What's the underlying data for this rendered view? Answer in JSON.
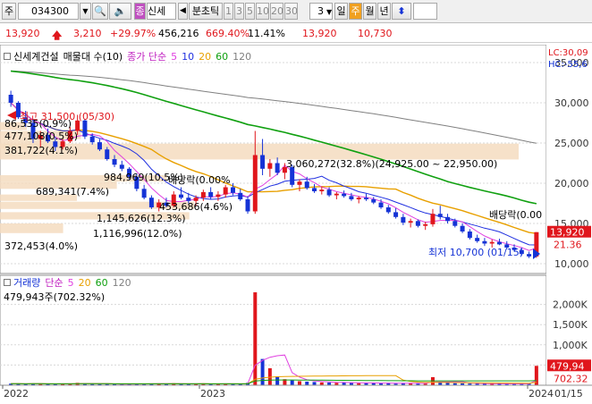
{
  "toolbar": {
    "market": "주",
    "code": "034300",
    "search_icon": "magnifier-icon",
    "sound_icon": "speaker-icon",
    "related_btn": "종",
    "name": "신세",
    "prev_icon": "triangle-left-icon",
    "tick_label": "분초틱",
    "periods": [
      "1",
      "3",
      "5",
      "10",
      "20",
      "30"
    ],
    "count": "3",
    "frames": [
      "일",
      "주",
      "월",
      "년"
    ],
    "active_frame": "주",
    "updown_icon": "up-down-arrow-icon"
  },
  "quote": {
    "price": "13,920",
    "up_icon": "red-up-arrow-icon",
    "change": "3,210",
    "change_pct": "+29.97%",
    "volume": "456,216",
    "volume_pct": "669.40%",
    "turnover": "11.41%",
    "high": "13,920",
    "low": "10,730"
  },
  "price_legend": {
    "name": "신세계건설",
    "series": "매물대 수(10)",
    "ma_label": "종가 단순",
    "ma": [
      "5",
      "10",
      "20",
      "60",
      "120"
    ],
    "ma_colors": [
      "#e040e0",
      "#2030e0",
      "#e8a000",
      "#10a010",
      "#808080"
    ],
    "lc_label": "LC:30,09",
    "hc_label": "HC:-55,6"
  },
  "volume_legend": {
    "name": "거래량",
    "ma_label": "단순",
    "ma": [
      "5",
      "20",
      "60",
      "120"
    ],
    "value": "479,943주(702.32%)"
  },
  "volume_profile": [
    {
      "label": "3,060,272(32.8%)(24,925.00 ~ 22,950.00)",
      "value": 3060272
    },
    {
      "label": "1,145,626(12.3%)",
      "value": 1145626
    },
    {
      "label": "1,116,996(12.0%)",
      "value": 1116996
    },
    {
      "label": "984,969(10.5%)",
      "value": 984969
    },
    {
      "label": "689,341(7.4%)",
      "value": 689341
    },
    {
      "label": "453,686(4.6%)",
      "value": 453686
    },
    {
      "label": "381,722(4.1%)",
      "value": 381722
    },
    {
      "label": "477,108(0.5%)",
      "value": 477108
    },
    {
      "label": "86,535(0.9%)",
      "value": 86535
    },
    {
      "label": "372,453(4.0%)",
      "value": 372453
    }
  ],
  "annotations": {
    "high": "최고 31,500 (05/30)",
    "low": "최저 10,700 (01/15)",
    "dividend1": "배당락(0.00%",
    "dividend2": "배당락(0.00"
  },
  "price_axis": {
    "ticks": [
      "35,000",
      "30,000",
      "25,000",
      "20,000",
      "15,000",
      "10,000"
    ],
    "current": "13,920",
    "current_pct": "21.36"
  },
  "volume_axis": {
    "ticks": [
      "2,000K",
      "1,500K",
      "1,000K",
      "500K"
    ],
    "current": "479,94",
    "current_pct": "702.32"
  },
  "x_labels": [
    "2022",
    "2023",
    "2024"
  ],
  "x_last": "01/15",
  "chart_data": {
    "type": "candlestick",
    "unit": "KRW",
    "interval": "weekly",
    "ohlc": [
      [
        31000,
        31500,
        29500,
        30000
      ],
      [
        30000,
        30200,
        28000,
        28200
      ],
      [
        28200,
        29000,
        27000,
        27500
      ],
      [
        27500,
        28000,
        25000,
        25500
      ],
      [
        25500,
        26500,
        24500,
        26000
      ],
      [
        26000,
        26800,
        25000,
        25200
      ],
      [
        25200,
        25800,
        24000,
        24500
      ],
      [
        24500,
        25500,
        24200,
        25200
      ],
      [
        25200,
        27000,
        25000,
        26500
      ],
      [
        26500,
        28500,
        26000,
        27800
      ],
      [
        27800,
        28000,
        25500,
        25800
      ],
      [
        25800,
        26200,
        24800,
        25100
      ],
      [
        25100,
        25500,
        24000,
        24200
      ],
      [
        24200,
        24500,
        22800,
        23000
      ],
      [
        23000,
        23500,
        22000,
        22300
      ],
      [
        22300,
        22800,
        21500,
        21800
      ],
      [
        21800,
        22000,
        20500,
        20800
      ],
      [
        20800,
        21200,
        19000,
        19300
      ],
      [
        19300,
        19800,
        18000,
        18200
      ],
      [
        18200,
        18500,
        16800,
        17000
      ],
      [
        17000,
        18000,
        16500,
        17600
      ],
      [
        17600,
        18200,
        17000,
        17200
      ],
      [
        17200,
        19000,
        17000,
        18600
      ],
      [
        18600,
        19500,
        18000,
        18200
      ],
      [
        18200,
        18800,
        17500,
        17800
      ],
      [
        17800,
        18500,
        17200,
        18200
      ],
      [
        18200,
        19200,
        17800,
        18900
      ],
      [
        18900,
        19500,
        18000,
        18300
      ],
      [
        18300,
        19000,
        17800,
        18600
      ],
      [
        18600,
        19800,
        18200,
        19500
      ],
      [
        19500,
        20000,
        18500,
        18800
      ],
      [
        18800,
        19300,
        17800,
        18000
      ],
      [
        18000,
        18400,
        16200,
        16500
      ],
      [
        16500,
        26500,
        16200,
        23500
      ],
      [
        23500,
        25500,
        21000,
        21800
      ],
      [
        21800,
        23000,
        20800,
        22500
      ],
      [
        22500,
        23200,
        21000,
        21300
      ],
      [
        21300,
        22500,
        20500,
        22000
      ],
      [
        22000,
        22300,
        19500,
        19800
      ],
      [
        19800,
        20500,
        19000,
        20200
      ],
      [
        20200,
        20800,
        19200,
        19400
      ],
      [
        19400,
        19900,
        18800,
        19000
      ],
      [
        19000,
        19600,
        18600,
        19200
      ],
      [
        19200,
        19500,
        18300,
        18500
      ],
      [
        18500,
        18900,
        18000,
        18700
      ],
      [
        18700,
        19100,
        18200,
        18400
      ],
      [
        18400,
        18800,
        17800,
        18000
      ],
      [
        18000,
        18400,
        17500,
        18200
      ],
      [
        18200,
        18700,
        17800,
        18000
      ],
      [
        18000,
        18300,
        17400,
        17600
      ],
      [
        17600,
        18000,
        16800,
        17000
      ],
      [
        17000,
        17300,
        16200,
        16400
      ],
      [
        16400,
        16900,
        15600,
        15800
      ],
      [
        15800,
        16200,
        14800,
        15100
      ],
      [
        15100,
        15600,
        14500,
        15300
      ],
      [
        15300,
        15500,
        14500,
        14700
      ],
      [
        14700,
        15200,
        14200,
        14900
      ],
      [
        14900,
        16800,
        14600,
        16200
      ],
      [
        16200,
        17200,
        15500,
        15800
      ],
      [
        15800,
        16200,
        15000,
        15300
      ],
      [
        15300,
        15600,
        14500,
        14700
      ],
      [
        14700,
        15000,
        13800,
        14000
      ],
      [
        14000,
        14300,
        13000,
        13200
      ],
      [
        13200,
        13600,
        12600,
        12800
      ],
      [
        12800,
        13200,
        12200,
        12500
      ],
      [
        12500,
        13000,
        12000,
        12700
      ],
      [
        12700,
        13100,
        12300,
        12400
      ],
      [
        12400,
        12800,
        11800,
        12000
      ],
      [
        12000,
        12400,
        11500,
        11700
      ],
      [
        11700,
        12000,
        11000,
        11200
      ],
      [
        11200,
        11500,
        10700,
        10900
      ],
      [
        10900,
        13920,
        10730,
        13920
      ]
    ],
    "volume_k": [
      40,
      35,
      30,
      45,
      38,
      30,
      28,
      32,
      45,
      60,
      40,
      30,
      28,
      35,
      30,
      25,
      30,
      40,
      35,
      45,
      38,
      30,
      50,
      35,
      28,
      30,
      45,
      30,
      28,
      40,
      35,
      30,
      60,
      2300,
      650,
      420,
      220,
      150,
      120,
      100,
      90,
      80,
      70,
      65,
      60,
      70,
      55,
      50,
      55,
      60,
      50,
      45,
      40,
      55,
      50,
      45,
      40,
      200,
      80,
      60,
      50,
      45,
      40,
      38,
      35,
      40,
      35,
      30,
      32,
      35,
      40,
      480
    ],
    "ylim": [
      9000,
      37000
    ]
  }
}
